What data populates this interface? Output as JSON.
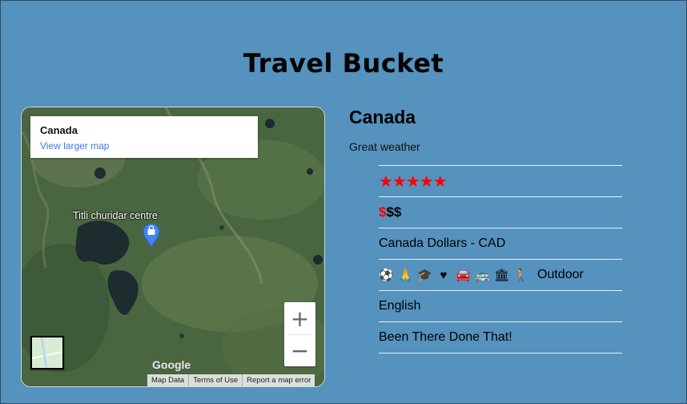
{
  "page": {
    "title": "Travel Bucket"
  },
  "map": {
    "place_name": "Canada",
    "view_larger": "View larger map",
    "poi_label": "Titli churidar centre",
    "zoom_in": "+",
    "zoom_out": "−",
    "logo": "Google",
    "attribution": [
      "Map Data",
      "Terms of Use",
      "Report a map error"
    ]
  },
  "destination": {
    "name": "Canada",
    "description": "Great weather",
    "rating": {
      "value": 5,
      "max": 5,
      "glyphs": "★★★★★"
    },
    "cost": {
      "active": "$",
      "inactive": "$$",
      "level": 1,
      "max": 3
    },
    "currency": "Canada Dollars - CAD",
    "activities": {
      "icons": [
        "soccer-ball-icon",
        "praying-hands-icon",
        "graduation-cap-icon",
        "heart-icon",
        "car-icon",
        "bus-icon",
        "museum-icon",
        "hiker-icon"
      ],
      "glyphs": [
        "⚽",
        "🙏",
        "🎓",
        "♥",
        "🚘",
        "🚌",
        "🏛",
        "🚶"
      ],
      "label": "Outdoor"
    },
    "language": "English",
    "status": "Been There Done That!"
  },
  "colors": {
    "background": "#5592bd",
    "star": "#ff0000",
    "dollar_active": "#ff0000",
    "link": "#3b78e7"
  }
}
